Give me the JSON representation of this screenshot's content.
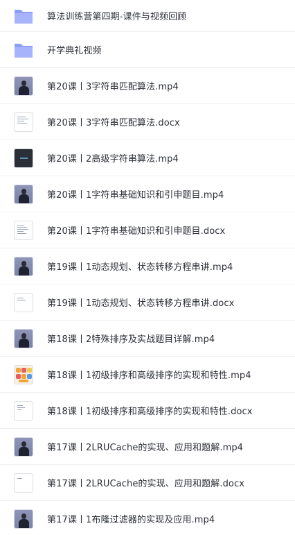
{
  "files": [
    {
      "name": "算法训练营第四期-课件与视频回顾",
      "kind": "folder"
    },
    {
      "name": "开学典礼视频",
      "kind": "folder"
    },
    {
      "name": "第20课丨3字符串匹配算法.mp4",
      "kind": "video"
    },
    {
      "name": "第20课丨3字符串匹配算法.docx",
      "kind": "doc"
    },
    {
      "name": "第20课丨2高级字符串算法.mp4",
      "kind": "video-dark"
    },
    {
      "name": "第20课丨1字符串基础知识和引申题目.mp4",
      "kind": "video"
    },
    {
      "name": "第20课丨1字符串基础知识和引申题目.docx",
      "kind": "doc"
    },
    {
      "name": "第19课丨1动态规划、状态转移方程串讲.mp4",
      "kind": "video"
    },
    {
      "name": "第19课丨1动态规划、状态转移方程串讲.docx",
      "kind": "doc"
    },
    {
      "name": "第18课丨2特殊排序及实战题目详解.mp4",
      "kind": "video"
    },
    {
      "name": "第18课丨1初级排序和高级排序的实现和特性.mp4",
      "kind": "video-color"
    },
    {
      "name": "第18课丨1初级排序和高级排序的实现和特性.docx",
      "kind": "doc"
    },
    {
      "name": "第17课丨2LRUCache的实现、应用和题解.mp4",
      "kind": "video"
    },
    {
      "name": "第17课丨2LRUCache的实现、应用和题解.docx",
      "kind": "doc"
    },
    {
      "name": "第17课丨1布隆过滤器的实现及应用.mp4",
      "kind": "video"
    }
  ],
  "colors": {
    "folder_back": "#8f9ef5",
    "folder_front": "#a7b3fb",
    "divider": "#eef0f3",
    "text": "#2b2f36"
  }
}
